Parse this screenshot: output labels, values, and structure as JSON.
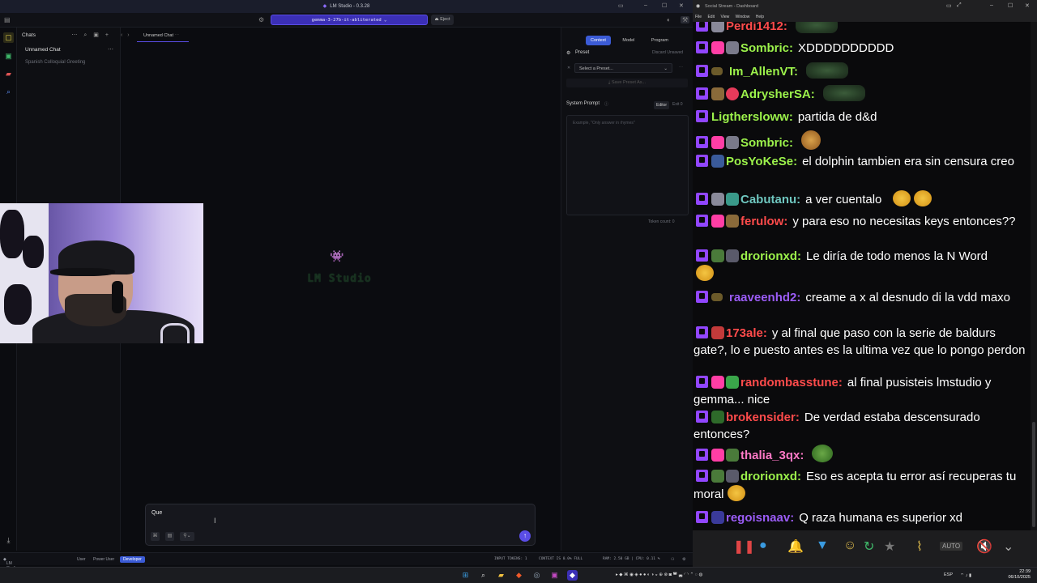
{
  "lm_studio": {
    "window_title": "LM Studio - 0.3.28",
    "model_name": "gemma-3-27b-it-abliterated",
    "eject_label": "Eject",
    "chats_title": "Chats",
    "chat_list": [
      {
        "label": "Unnamed Chat",
        "active": true
      },
      {
        "label": "Spanish Colloquial Greeting",
        "active": false
      }
    ],
    "chat_tab": "Unnamed Chat",
    "splash_text": "LM Studio",
    "composer_text": "Que",
    "right_tabs": [
      "Context",
      "Model",
      "Program"
    ],
    "preset_label": "Preset",
    "discard_label": "Discard Unsaved",
    "preset_placeholder": "Select a Preset...",
    "save_preset_label": "Save Preset As...",
    "system_prompt_label": "System Prompt",
    "editor_label": "Editor",
    "exit_label": "Exit 0",
    "system_prompt_placeholder": "Example, \"Only answer in rhymes\"",
    "token_count": "Token count: 0",
    "status": {
      "app_build": "LM Studio 0.3.28 (Build 2)",
      "user": "User",
      "power_user": "Power User",
      "developer": "Developer",
      "input_tokens": "INPUT TOKENS: 1",
      "context": "CONTEXT IS 0.0% FULL",
      "ram_cpu": "RAM: 2.50 GB | CPU: 0.11 %"
    }
  },
  "social_stream": {
    "window_title": "Social Stream - Dashboard",
    "menu": [
      "File",
      "Edit",
      "View",
      "Window",
      "Help"
    ],
    "messages": [
      {
        "user": "Perdi1412:",
        "color": "#ff4b4b",
        "text": "",
        "emote": true
      },
      {
        "user": "Sombric:",
        "color": "#9cf24b",
        "text": "XDDDDDDDDDD",
        "emote": false
      },
      {
        "user": "Im_AllenVT:",
        "color": "#9cf24b",
        "text": "",
        "emote": true
      },
      {
        "user": "AdrysherSA:",
        "color": "#9cf24b",
        "text": "",
        "emote": true
      },
      {
        "user": "Ligthersloww:",
        "color": "#9cf24b",
        "text": "partida de d&d",
        "emote": false
      },
      {
        "user": "Sombric:",
        "color": "#9cf24b",
        "text": "",
        "emote": true
      },
      {
        "user": "PosYoKeSe:",
        "color": "#9cf24b",
        "text": "el dolphin tambien era sin censura creo",
        "emote": false
      },
      {
        "user": "Cabutanu:",
        "color": "#6fc7c0",
        "text": "a ver cuentalo",
        "emote": true
      },
      {
        "user": "ferulow:",
        "color": "#ff4b4b",
        "text": "y para eso no necesitas keys entonces??",
        "emote": false
      },
      {
        "user": "drorionxd:",
        "color": "#9cf24b",
        "text": "Le diría de todo menos la N Word",
        "emote": false
      },
      {
        "user": "raaveenhd2:",
        "color": "#9b5cf6",
        "text": "creame a x al desnudo di la vdd maxo",
        "emote": false
      },
      {
        "user": "173ale:",
        "color": "#ff4b4b",
        "text": "y al final que paso con la serie de baldurs gate?, lo e puesto antes es la ultima vez que lo pongo perdon",
        "emote": false
      },
      {
        "user": "randombasstune:",
        "color": "#ff4b4b",
        "text": "al final pusisteis lmstudio y gemma... nice",
        "emote": false
      },
      {
        "user": "brokensider:",
        "color": "#ff4b4b",
        "text": "De verdad estaba descensurado entonces?",
        "emote": false
      },
      {
        "user": "thalia_3qx:",
        "color": "#ff79c6",
        "text": "",
        "emote": true
      },
      {
        "user": "drorionxd:",
        "color": "#9cf24b",
        "text": "Eso es acepta tu error así recuperas tu moral",
        "emote": true
      },
      {
        "user": "regoisnaav:",
        "color": "#9b5cf6",
        "text": "Q raza humana es superior xd",
        "emote": false
      }
    ]
  },
  "taskbar": {
    "lang": "ESP",
    "time": "22:39",
    "date": "06/10/2025"
  }
}
